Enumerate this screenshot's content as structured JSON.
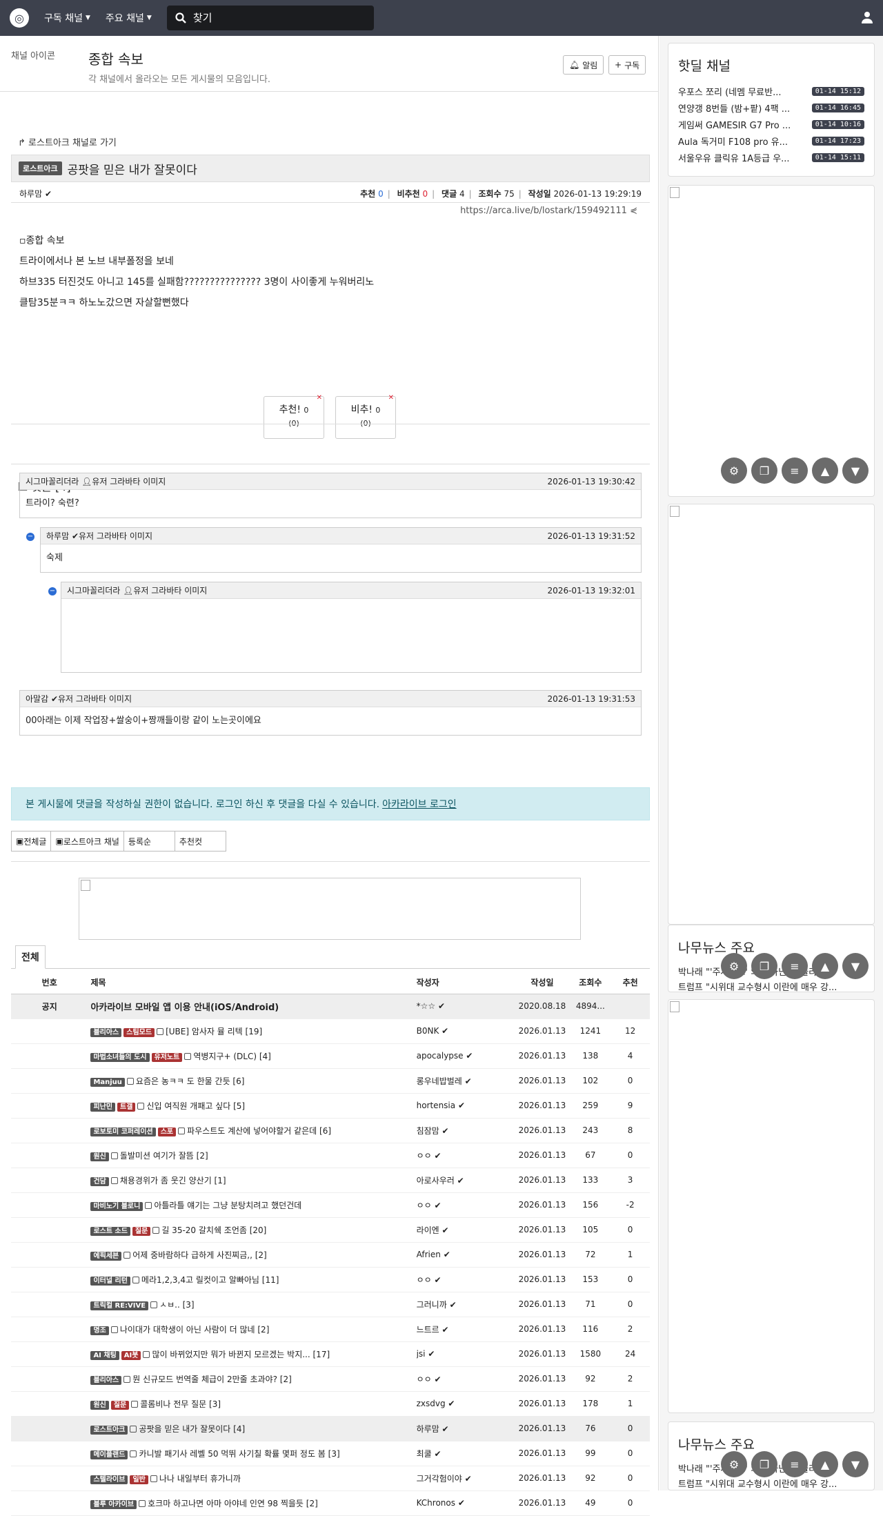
{
  "nav": {
    "subscribed": "구독 채널",
    "major": "주요 채널",
    "search_placeholder": "찾기"
  },
  "channel": {
    "avatar_alt": "채널 아이콘",
    "title": "종합 속보",
    "desc": "각 채널에서 올라오는 모든 게시물의 모음입니다.",
    "alarm": "알림",
    "subscribe": "구독"
  },
  "post": {
    "back": "로스트아크 채널로 가기",
    "badge": "로스트아크",
    "title": "공팟을 믿은 내가 잘못이다",
    "author": "하루맘",
    "rec_label": "추천",
    "rec": "0",
    "nrec_label": "비추천",
    "nrec": "0",
    "cmt_label": "댓글",
    "cmt": "4",
    "view_label": "조회수",
    "view": "75",
    "date_label": "작성일",
    "date": "2026-01-13 19:29:19",
    "url": "https://arca.live/b/lostark/159492111",
    "img_alt": "종합 속보",
    "lines": [
      "트라이에서나 본 노브 내부폴정을 보네",
      "하브335 터진것도 아니고 145를 실패함??????????????? 3명이 사이좋게 누워버리노",
      "클탐35분ㅋㅋ 하노노갔으면 자살할뻔했다"
    ],
    "vote_up": "추천!",
    "vote_up_n": "0",
    "vote_up_sub": "(0)",
    "vote_down": "비추!",
    "vote_down_n": "0",
    "vote_down_sub": "(0)"
  },
  "comments": {
    "header": "댓글 [4]",
    "avatar_alt": "유저 그라바타 이미지",
    "items": [
      {
        "author": "시그마꼴리더라",
        "date": "2026-01-13 19:30:42",
        "text": "트라이? 숙련?"
      },
      {
        "author": "하루맘",
        "date": "2026-01-13 19:31:52",
        "text": "숙제"
      },
      {
        "author": "시그마꼴리더라",
        "date": "2026-01-13 19:32:01",
        "text": ""
      },
      {
        "author": "아말감",
        "date": "2026-01-13 19:31:53",
        "text": "00아래는 이제 작업장+쌀숭이+짱깨들이랑 같이 노는곳이에요"
      }
    ]
  },
  "notice": {
    "text": "본 게시물에 댓글을 작성하실 권한이 없습니다. 로그인 하신 후 댓글을 다실 수 있습니다.",
    "link": "아카라이브 로그인"
  },
  "listtabs": [
    "전체글",
    "로스트아크 채널",
    "등록순",
    "추천컷"
  ],
  "board": {
    "tab": "전체",
    "headers": [
      "번호",
      "제목",
      "작성자",
      "작성일",
      "조회수",
      "추천"
    ],
    "notice_row": {
      "no": "공지",
      "title": "아카라이브 모바일 앱 이용 안내(iOS/Android)",
      "author": "*☆☆",
      "date": "2020.08.18",
      "view": "4894...",
      "rec": ""
    },
    "rows": [
      {
        "b1": "블리아스",
        "b2": "스팀모드",
        "title": "[UBE] 암사자 뮬 리텍 [19]",
        "author": "B0NK",
        "view": "1241",
        "rec": "12"
      },
      {
        "b1": "마법소녀들의 도시",
        "b2": "유저노트",
        "title": "역병지구+ (DLC) [4]",
        "author": "apocalypse",
        "view": "138",
        "rec": "4"
      },
      {
        "b1": "Manjuu",
        "b2": "",
        "title": "요즘은 농ㅋㅋ 도 한물 간듯 [6]",
        "author": "롱우네밥벌레",
        "view": "102",
        "rec": "0"
      },
      {
        "b1": "피난민",
        "b2": "트갤",
        "title": "신입 여직원 개패고 싶다 [5]",
        "author": "hortensia",
        "view": "259",
        "rec": "9"
      },
      {
        "b1": "로보토미 코퍼레이션",
        "b2": "스포",
        "title": "파우스트도 계산에 넣어야할거 같은데 [6]",
        "author": "침잠맘",
        "view": "243",
        "rec": "8"
      },
      {
        "b1": "원신",
        "b2": "",
        "title": "돌발미션 여기가 잘뜸 [2]",
        "author": "ㅇㅇ",
        "view": "67",
        "rec": "0"
      },
      {
        "b1": "건담",
        "b2": "",
        "title": "채용경위가 좀 웃긴 양산기 [1]",
        "author": "아로사우러",
        "view": "133",
        "rec": "3"
      },
      {
        "b1": "마비노기 블로니",
        "b2": "",
        "title": "아틀라틀 얘기는 그냥 분탕치려고 했던건데",
        "author": "ㅇㅇ",
        "view": "156",
        "rec": "-2"
      },
      {
        "b1": "로스트 소드",
        "b2": "질문",
        "title": "길 35-20 갈치쉑 조언좀 [20]",
        "author": "라이엔",
        "view": "105",
        "rec": "0"
      },
      {
        "b1": "에픽세븐",
        "b2": "",
        "title": "어제 중바람하다 급하게 사진찌금,, [2]",
        "author": "Afrien",
        "view": "72",
        "rec": "1"
      },
      {
        "b1": "이터널 리턴",
        "b2": "",
        "title": "메라1,2,3,4고 릴컷이고 알빠아님 [11]",
        "author": "ㅇㅇ",
        "view": "153",
        "rec": "0"
      },
      {
        "b1": "트릭컬 RE:VIVE",
        "b2": "",
        "title": "ㅅㅂ.. [3]",
        "author": "그러니까",
        "view": "71",
        "rec": "0"
      },
      {
        "b1": "명조",
        "b2": "",
        "title": "나이대가 대학생이 아닌 사람이 더 많네 [2]",
        "author": "느트르",
        "view": "116",
        "rec": "2"
      },
      {
        "b1": "AI 채팅",
        "b2": "AI봇",
        "title": "많이 바뀌었지만 뭐가 바뀐지 모르겠는 박지... [17]",
        "author": "jsi",
        "view": "1580",
        "rec": "24"
      },
      {
        "b1": "블리아스",
        "b2": "",
        "title": "뭔 신규모드 번역줄 체급이 2만줄 초과야? [2]",
        "author": "ㅇㅇ",
        "view": "92",
        "rec": "2"
      },
      {
        "b1": "원신",
        "b2": "질문",
        "title": "콜롬비나 전무 질문 [3]",
        "author": "zxsdvg",
        "view": "178",
        "rec": "1"
      },
      {
        "b1": "로스트아크",
        "b2": "",
        "title": "공팟을 믿은 내가 잘못이다 [4]",
        "author": "하루맘",
        "view": "76",
        "rec": "0",
        "hl": true
      },
      {
        "b1": "메이플랜드",
        "b2": "",
        "title": "카니발 패기사 레벨 50 먹뛰 사기칠 확률 몇퍼 정도 봄 [3]",
        "author": "최쿨",
        "view": "99",
        "rec": "0"
      },
      {
        "b1": "스텔라이브",
        "b2": "일반",
        "title": "나나 내일부터 휴가니까",
        "author": "그거각험이야",
        "view": "92",
        "rec": "0"
      },
      {
        "b1": "블루 아카이브",
        "b2": "",
        "title": "호크마 하고나면 아마 아야네 인연 98 찍을듯 [2]",
        "author": "KChronos",
        "view": "49",
        "rec": "0"
      }
    ],
    "row_date": "2026.01.13"
  },
  "side": {
    "hot_title": "핫딜 채널",
    "hot": [
      {
        "t": "우포스 쪼리 (네멤 무료반...",
        "tm": "01-14 15:12"
      },
      {
        "t": "연양갱 8번들 (밤+팥) 4팩 ...",
        "tm": "01-14 16:45"
      },
      {
        "t": "게임써 GAMESIR G7 Pro ...",
        "tm": "01-14 10:16"
      },
      {
        "t": "Aula 독거미 F108 pro 유...",
        "tm": "01-14 17:23"
      },
      {
        "t": "서울우유 클릭유 1A등급 우...",
        "tm": "01-14 15:11"
      }
    ],
    "news_title": "나무뉴스 주요",
    "news": [
      "박나래 \"'주사이모' 의사 아닌 줄 몰라\"...",
      "트럼프 \"시위대 교수형시 이란에 매우 강..."
    ]
  }
}
